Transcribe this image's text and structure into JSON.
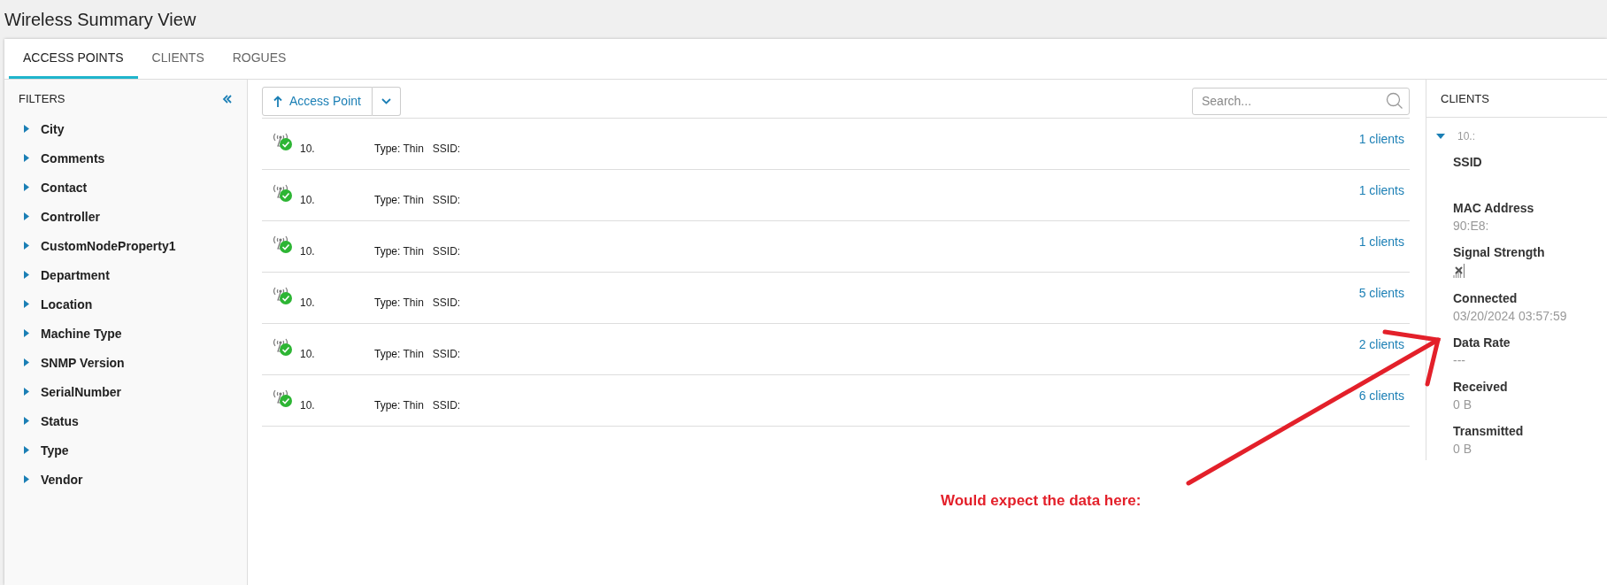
{
  "page_title": "Wireless Summary View",
  "tabs": [
    {
      "label": "ACCESS POINTS",
      "selected": true
    },
    {
      "label": "CLIENTS",
      "selected": false
    },
    {
      "label": "ROGUES",
      "selected": false
    }
  ],
  "filters": {
    "title": "FILTERS",
    "items": [
      {
        "label": "City",
        "expanded": false
      },
      {
        "label": "Comments",
        "expanded": false
      },
      {
        "label": "Contact",
        "expanded": false
      },
      {
        "label": "Controller",
        "expanded": false
      },
      {
        "label": "CustomNodeProperty1",
        "expanded": false
      },
      {
        "label": "Department",
        "expanded": false
      },
      {
        "label": "Location",
        "expanded": false
      },
      {
        "label": "Machine Type",
        "expanded": false
      },
      {
        "label": "SNMP Version",
        "expanded": false
      },
      {
        "label": "SerialNumber",
        "expanded": false
      },
      {
        "label": "Status",
        "expanded": false
      },
      {
        "label": "Type",
        "expanded": false
      },
      {
        "label": "Vendor",
        "expanded": false
      }
    ]
  },
  "toolbar": {
    "sort_label": "Access Point"
  },
  "search": {
    "placeholder": "Search..."
  },
  "access_points": [
    {
      "address": "10.",
      "type_label": "Type:",
      "type_value": "Thin",
      "ssid_label": "SSID:",
      "clients": "1 clients",
      "up": true
    },
    {
      "address": "10.",
      "type_label": "Type:",
      "type_value": "Thin",
      "ssid_label": "SSID:",
      "clients": "1 clients",
      "up": true
    },
    {
      "address": "10.",
      "type_label": "Type:",
      "type_value": "Thin",
      "ssid_label": "SSID:",
      "clients": "1 clients",
      "up": true
    },
    {
      "address": "10.",
      "type_label": "Type:",
      "type_value": "Thin",
      "ssid_label": "SSID:",
      "clients": "5 clients",
      "up": true
    },
    {
      "address": "10.",
      "type_label": "Type:",
      "type_value": "Thin",
      "ssid_label": "SSID:",
      "clients": "2 clients",
      "up": true
    },
    {
      "address": "10.",
      "type_label": "Type:",
      "type_value": "Thin",
      "ssid_label": "SSID:",
      "clients": "6 clients",
      "up": true
    }
  ],
  "clients_panel": {
    "title": "CLIENTS",
    "client": {
      "address": "10.:",
      "expanded": true,
      "fields": [
        {
          "kind": "text",
          "label": "SSID"
        },
        {
          "kind": "text",
          "label": "MAC Address",
          "value": "90:E8:"
        },
        {
          "kind": "signal",
          "label": "Signal Strength"
        },
        {
          "kind": "text",
          "label": "Connected",
          "value": "03/20/2024 03:57:59"
        },
        {
          "kind": "text",
          "label": "Data Rate",
          "value": "---"
        },
        {
          "kind": "text",
          "label": "Received",
          "value": "0 B"
        },
        {
          "kind": "text",
          "label": "Transmitted",
          "value": "0 B"
        }
      ]
    }
  },
  "annotation": {
    "text": "Would expect the data here:"
  }
}
